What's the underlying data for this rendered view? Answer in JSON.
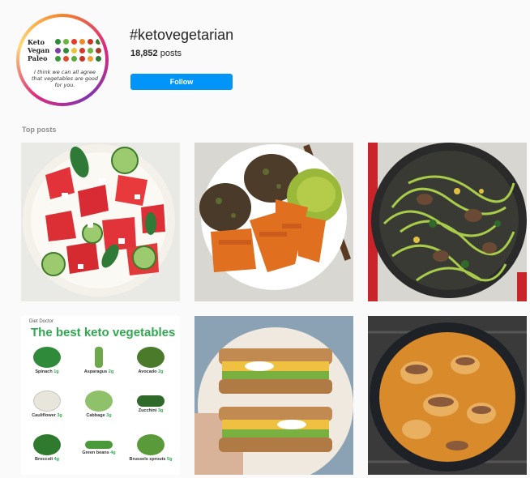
{
  "header": {
    "hashtag": "#ketovegetarian",
    "posts_count": "18,852",
    "posts_suffix": "posts",
    "follow_label": "Follow"
  },
  "avatar": {
    "words": [
      "Keto",
      "Vegan",
      "Paleo"
    ],
    "quote": "I think we can all agree that vegetables are good for you."
  },
  "sections": {
    "top_posts_label": "Top posts"
  },
  "posts": [
    {
      "subject": "watermelon cucumber feta salad bowl"
    },
    {
      "subject": "veggie patties with sweet potato wedges and guacamole"
    },
    {
      "subject": "zucchini noodles with mushrooms in skillet"
    },
    {
      "subject": "best keto vegetables infographic"
    },
    {
      "subject": "avocado egg sandwich"
    },
    {
      "subject": "mushroom stew in pot"
    }
  ],
  "infographic": {
    "brand": "Diet Doctor",
    "title": "The best keto vegetables",
    "items": [
      {
        "name": "Spinach",
        "carbs": "1g",
        "color": "#2f8a3a"
      },
      {
        "name": "Asparagus",
        "carbs": "2g",
        "color": "#6fa84a"
      },
      {
        "name": "Avocado",
        "carbs": "2g",
        "color": "#4a7a2a"
      },
      {
        "name": "Cauliflower",
        "carbs": "3g",
        "color": "#e8e6dc"
      },
      {
        "name": "Cabbage",
        "carbs": "3g",
        "color": "#8fc06a"
      },
      {
        "name": "Zucchini",
        "carbs": "3g",
        "color": "#2f6a2a"
      },
      {
        "name": "Broccoli",
        "carbs": "4g",
        "color": "#2f7a2f"
      },
      {
        "name": "Green beans",
        "carbs": "4g",
        "color": "#4a9a3a"
      },
      {
        "name": "Brussels sprouts",
        "carbs": "5g",
        "color": "#5a9a3a"
      }
    ]
  },
  "colors": {
    "accent": "#0095f6",
    "secondary_text": "#8e8e8e",
    "background": "#fafafa"
  }
}
